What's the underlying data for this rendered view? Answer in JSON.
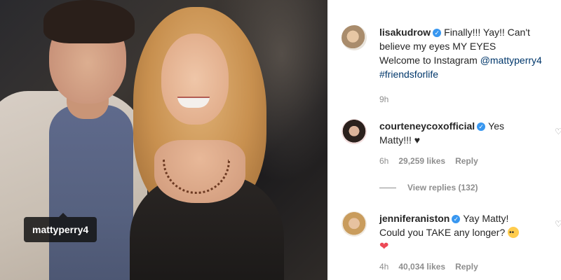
{
  "post": {
    "tag_username": "mattyperry4"
  },
  "caption": {
    "username": "lisakudrow",
    "text_line1": "Finally!!! Yay!! Can't",
    "text_line2": "believe my eyes MY EYES",
    "text_line3a": "Welcome to Instagram ",
    "mention": "@mattyperry4",
    "hashtag": "#friendsforlife",
    "time": "9h"
  },
  "comments": [
    {
      "username": "courteneycoxofficial",
      "text_a": "Yes",
      "text_b": "Matty!!! ♥",
      "time": "6h",
      "likes": "29,259 likes",
      "reply": "Reply",
      "view_replies": "View replies (132)"
    },
    {
      "username": "jenniferaniston",
      "text_a": "Yay Matty!",
      "text_b": "Could you TAKE any longer?",
      "heart": "❤",
      "time": "4h",
      "likes": "40,034 likes",
      "reply": "Reply"
    }
  ],
  "colors": {
    "link": "#00376b",
    "verified": "#3897f0",
    "meta": "#8e8e8e",
    "heart": "#ed4956"
  },
  "icons": {
    "verified": "verified-badge-icon",
    "like": "heart-outline-icon",
    "emoji": "flushed-face-icon"
  }
}
